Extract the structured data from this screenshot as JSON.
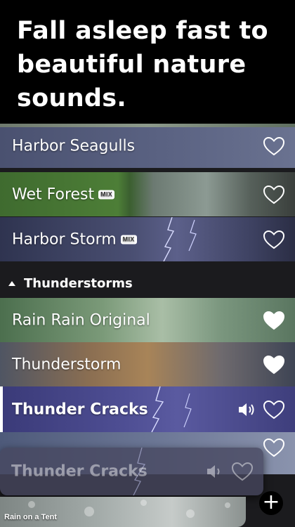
{
  "headline": "Fall asleep fast to beautiful nature sounds.",
  "rows": [
    {
      "label": "Harbor Seagulls",
      "mix": false,
      "favorited": false
    },
    {
      "label": "Wet Forest",
      "mix": true,
      "favorited": false
    },
    {
      "label": "Harbor Storm",
      "mix": true,
      "favorited": false
    }
  ],
  "mix_badge": "MIX",
  "section": {
    "title": "Thunderstorms",
    "expanded": true
  },
  "thunder_rows": [
    {
      "label": "Rain Rain Original",
      "favorited": true
    },
    {
      "label": "Thunderstorm",
      "favorited": true
    },
    {
      "label": "Thunder Cracks",
      "favorited": false,
      "playing": true
    }
  ],
  "drag_preview": {
    "label": "Thunder Cracks"
  },
  "mini_player": {
    "label": "Rain on a Tent"
  },
  "icons": {
    "heart": "heart-icon",
    "speaker": "speaker-icon",
    "add": "plus-icon",
    "collapse": "triangle-up-icon"
  },
  "colors": {
    "background": "#000000",
    "list_bg": "#1b1b1e",
    "text": "#ffffff"
  }
}
